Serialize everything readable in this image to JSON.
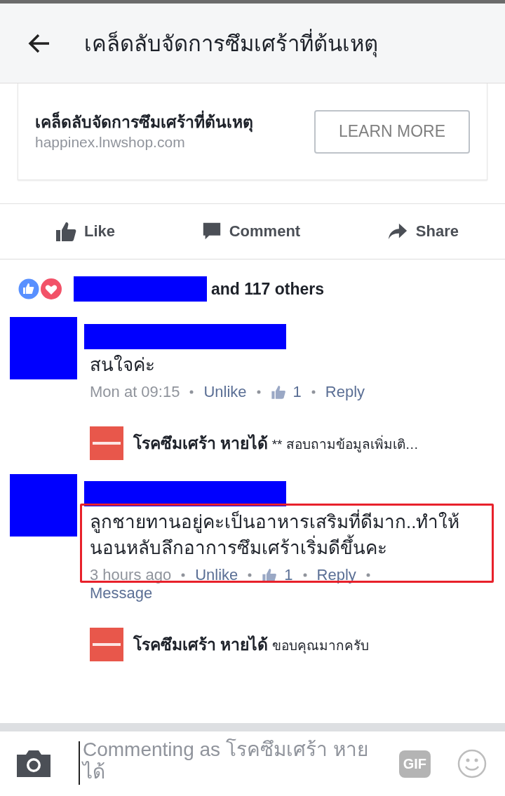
{
  "header": {
    "title": "เคล็ดลับจัดการซึมเศร้าที่ต้นเหตุ"
  },
  "link_card": {
    "title": "เคล็ดลับจัดการซึมเศร้าที่ต้นเหตุ",
    "domain": "happinex.lnwshop.com",
    "button": "LEARN MORE"
  },
  "actions": [
    {
      "kind": "like",
      "label": "Like"
    },
    {
      "kind": "comment",
      "label": "Comment"
    },
    {
      "kind": "share",
      "label": "Share"
    }
  ],
  "reactions": {
    "summary": "and 117 others"
  },
  "comments": [
    {
      "text": "สนใจค่ะ",
      "highlighted": false,
      "meta": {
        "time": "Mon at 09:15",
        "unlike": "Unlike",
        "likes": "1",
        "reply": "Reply"
      },
      "reply": {
        "author": "โรคซึมเศร้า หายได้",
        "text": "** สอบถามข้อมูลเพิ่มเติ…"
      }
    },
    {
      "text": "ลูกชายทานอยู่คะเป็นอาหารเสริมที่ดีมาก..ทำให้นอนหลับลึกอาการซึมเศร้าเริ่มดีขึ้นคะ",
      "highlighted": true,
      "meta": {
        "time": "3 hours ago",
        "unlike": "Unlike",
        "likes": "1",
        "reply": "Reply",
        "message": "Message"
      },
      "reply": {
        "author": "โรคซึมเศร้า หายได้",
        "text": "ขอบคุณมากครับ"
      }
    }
  ],
  "composer": {
    "placeholder": "Commenting as โรคซึมเศร้า หายได้",
    "gif": "GIF"
  }
}
